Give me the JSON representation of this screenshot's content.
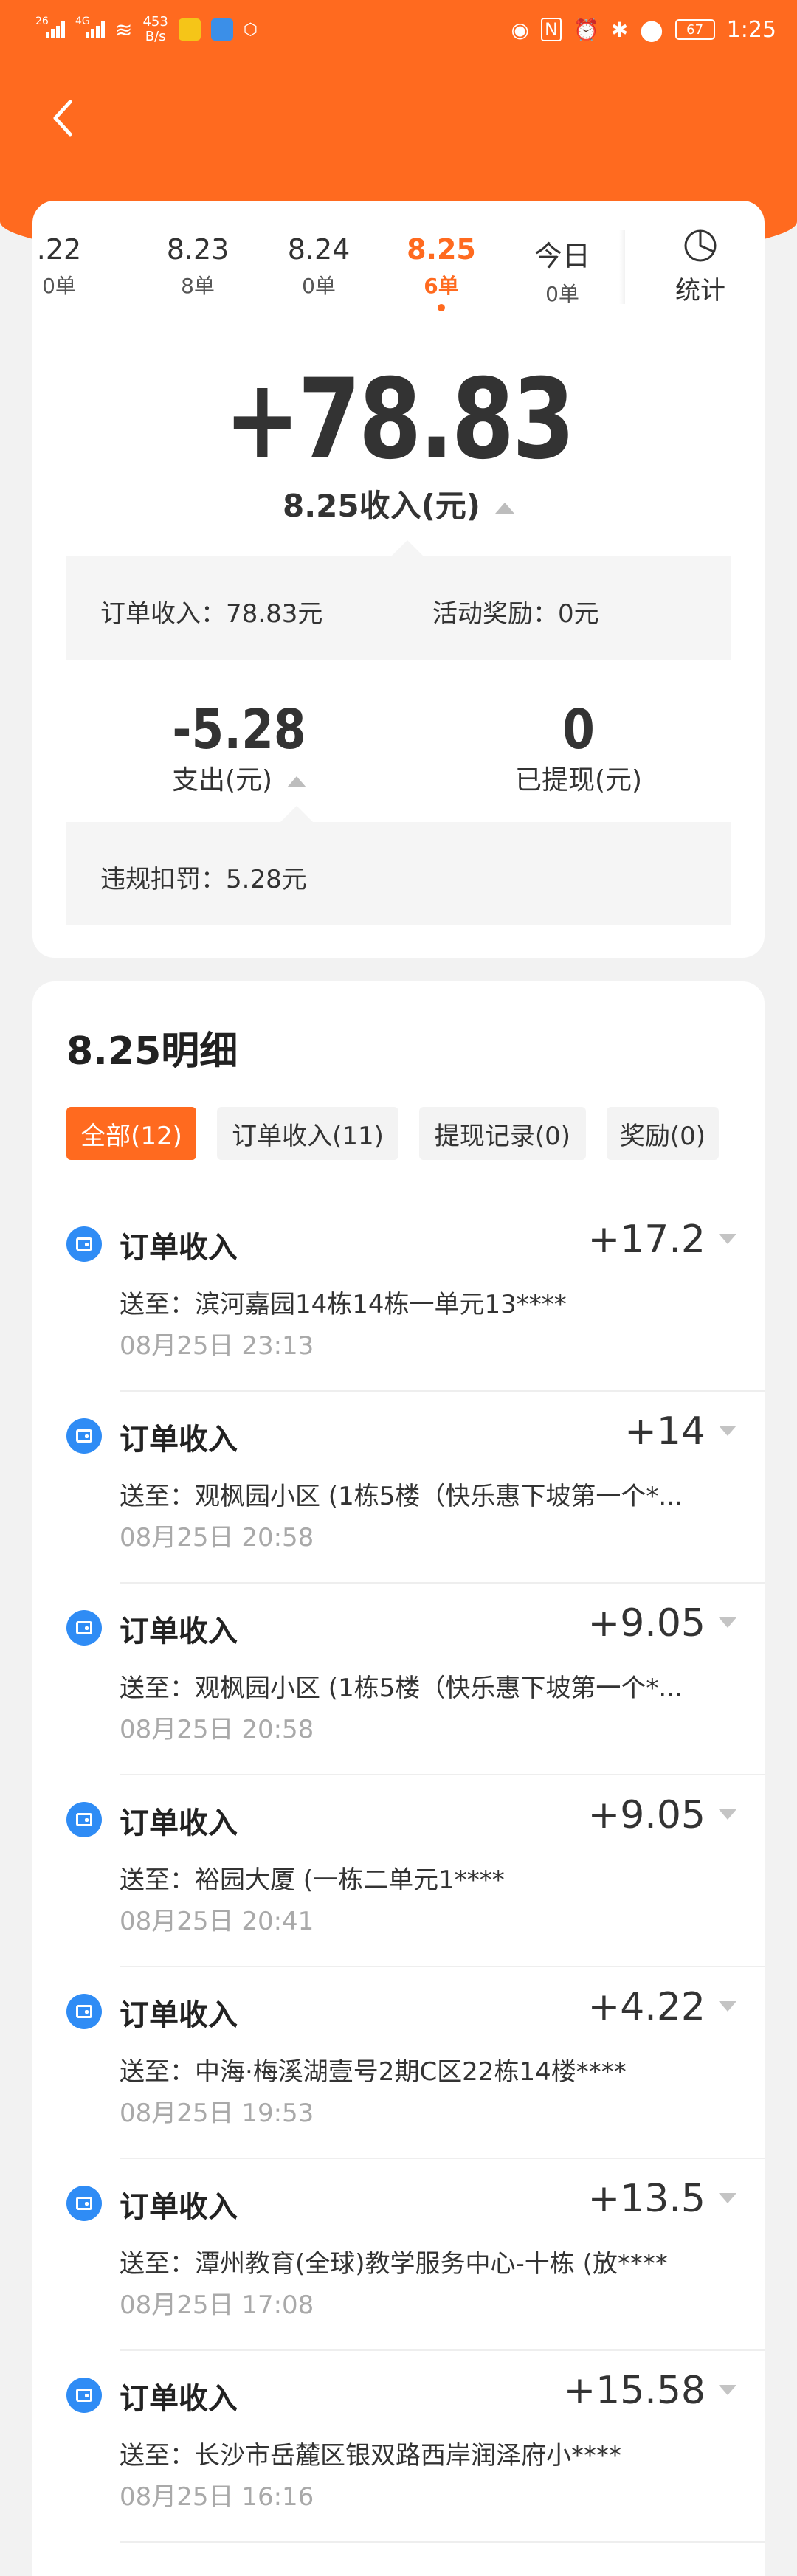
{
  "status_bar": {
    "signal1": "26",
    "signal2": "4G",
    "speed_value": "453",
    "speed_unit": "B/s",
    "battery": "67",
    "time": "1:25"
  },
  "date_tabs": [
    {
      "date": ".22",
      "count": "0单"
    },
    {
      "date": "8.23",
      "count": "8单"
    },
    {
      "date": "8.24",
      "count": "0单"
    },
    {
      "date": "8.25",
      "count": "6单"
    },
    {
      "date": "今日",
      "count": "0单"
    }
  ],
  "stats_label": "统计",
  "summary": {
    "amount": "+78.83",
    "label": "8.25收入(元)",
    "order_income_label": "订单收入：",
    "order_income_value": "78.83元",
    "activity_reward_label": "活动奖励：",
    "activity_reward_value": "0元",
    "expense_amount": "-5.28",
    "expense_label": "支出(元)",
    "withdrawn_amount": "0",
    "withdrawn_label": "已提现(元)",
    "penalty_label": "违规扣罚：",
    "penalty_value": "5.28元"
  },
  "detail": {
    "title": "8.25明细",
    "filters": [
      "全部(12)",
      "订单收入(11)",
      "提现记录(0)",
      "奖励(0)"
    ],
    "items": [
      {
        "title": "订单收入",
        "amount": "+17.2",
        "address": "送至：滨河嘉园14栋14栋一单元13****",
        "time": "08月25日 23:13"
      },
      {
        "title": "订单收入",
        "amount": "+14",
        "address": "送至：观枫园小区 (1栋5楼（快乐惠下坡第一个*...",
        "time": "08月25日 20:58"
      },
      {
        "title": "订单收入",
        "amount": "+9.05",
        "address": "送至：观枫园小区 (1栋5楼（快乐惠下坡第一个*...",
        "time": "08月25日 20:58"
      },
      {
        "title": "订单收入",
        "amount": "+9.05",
        "address": "送至：裕园大厦 (一栋二单元1****",
        "time": "08月25日 20:41"
      },
      {
        "title": "订单收入",
        "amount": "+4.22",
        "address": "送至：中海·梅溪湖壹号2期C区22栋14楼****",
        "time": "08月25日 19:53"
      },
      {
        "title": "订单收入",
        "amount": "+13.5",
        "address": "送至：潭州教育(全球)教学服务中心-十栋 (放****",
        "time": "08月25日 17:08"
      },
      {
        "title": "订单收入",
        "amount": "+15.58",
        "address": "送至：长沙市岳麓区银双路西岸润泽府小****",
        "time": "08月25日 16:16"
      }
    ]
  }
}
